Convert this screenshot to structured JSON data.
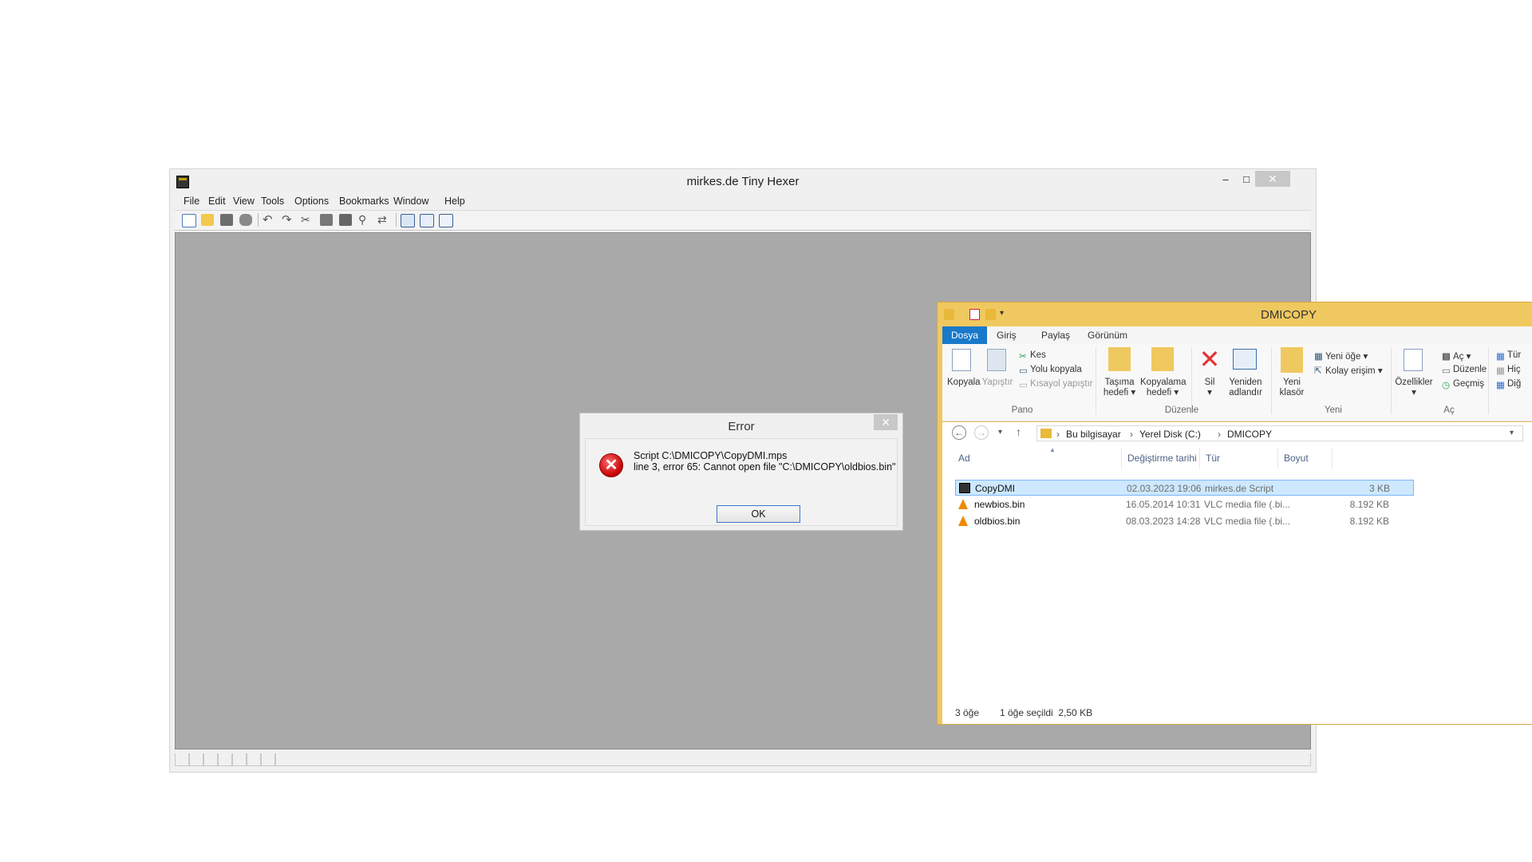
{
  "hexer": {
    "title": "mirkes.de Tiny Hexer",
    "minimize": "–",
    "maximize": "□",
    "close": "✕",
    "menu": [
      "File",
      "Edit",
      "View",
      "Tools",
      "Options",
      "Bookmarks",
      "Window",
      "Help"
    ],
    "toolbar_icons": [
      "new-file-icon",
      "open-folder-icon",
      "save-icon",
      "save-all-icon",
      "undo-icon",
      "redo-icon",
      "cut-icon",
      "copy-icon",
      "paste-icon",
      "find-icon",
      "replace-icon",
      "view-hex-icon",
      "view-text-icon",
      "view-tile-icon"
    ]
  },
  "error_dialog": {
    "title": "Error",
    "close": "✕",
    "icon_glyph": "✕",
    "line1": "Script C:\\DMICOPY\\CopyDMI.mps",
    "line2": "line 3, error 65: Cannot open file \"C:\\DMICOPY\\oldbios.bin\"",
    "ok_label": "OK"
  },
  "explorer": {
    "title": "DMICOPY",
    "tabs": {
      "file": "Dosya",
      "home": "Giriş",
      "share": "Paylaş",
      "view": "Görünüm"
    },
    "ribbon": {
      "copy": "Kopyala",
      "paste": "Yapıştır",
      "cut": "Kes",
      "copy_path": "Yolu kopyala",
      "paste_shortcut": "Kısayol yapıştır",
      "group_clipboard": "Pano",
      "move_to": [
        "Taşıma",
        "hedefi"
      ],
      "copy_to": [
        "Kopyalama",
        "hedefi"
      ],
      "delete": "Sil",
      "rename": [
        "Yeniden",
        "adlandır"
      ],
      "group_organize": "Düzenle",
      "new_folder": [
        "Yeni",
        "klasör"
      ],
      "new_item": "Yeni öğe",
      "easy_access": "Kolay erişim",
      "group_new": "Yeni",
      "properties": "Özellikler",
      "open": "Aç",
      "edit": "Düzenle",
      "history": "Geçmiş",
      "group_open": "Aç",
      "select_all_partial": "Tür",
      "select_none_partial": "Hiç",
      "invert_partial": "Diğ"
    },
    "address": {
      "crumbs": [
        "Bu bilgisayar",
        "Yerel Disk (C:)",
        "DMICOPY"
      ]
    },
    "columns": {
      "name": "Ad",
      "date": "Değiştirme tarihi",
      "type": "Tür",
      "size": "Boyut"
    },
    "files": [
      {
        "name": "CopyDMI",
        "date": "02.03.2023 19:06",
        "type": "mirkes.de Script",
        "size": "3 KB",
        "selected": true,
        "icon": "script-icon"
      },
      {
        "name": "newbios.bin",
        "date": "16.05.2014 10:31",
        "type": "VLC media file (.bi...",
        "size": "8.192 KB",
        "selected": false,
        "icon": "vlc-cone-icon"
      },
      {
        "name": "oldbios.bin",
        "date": "08.03.2023 14:28",
        "type": "VLC media file (.bi...",
        "size": "8.192 KB",
        "selected": false,
        "icon": "vlc-cone-icon"
      }
    ],
    "status": {
      "count": "3 öğe",
      "selection": "1 öğe seçildi  2,50 KB"
    }
  }
}
